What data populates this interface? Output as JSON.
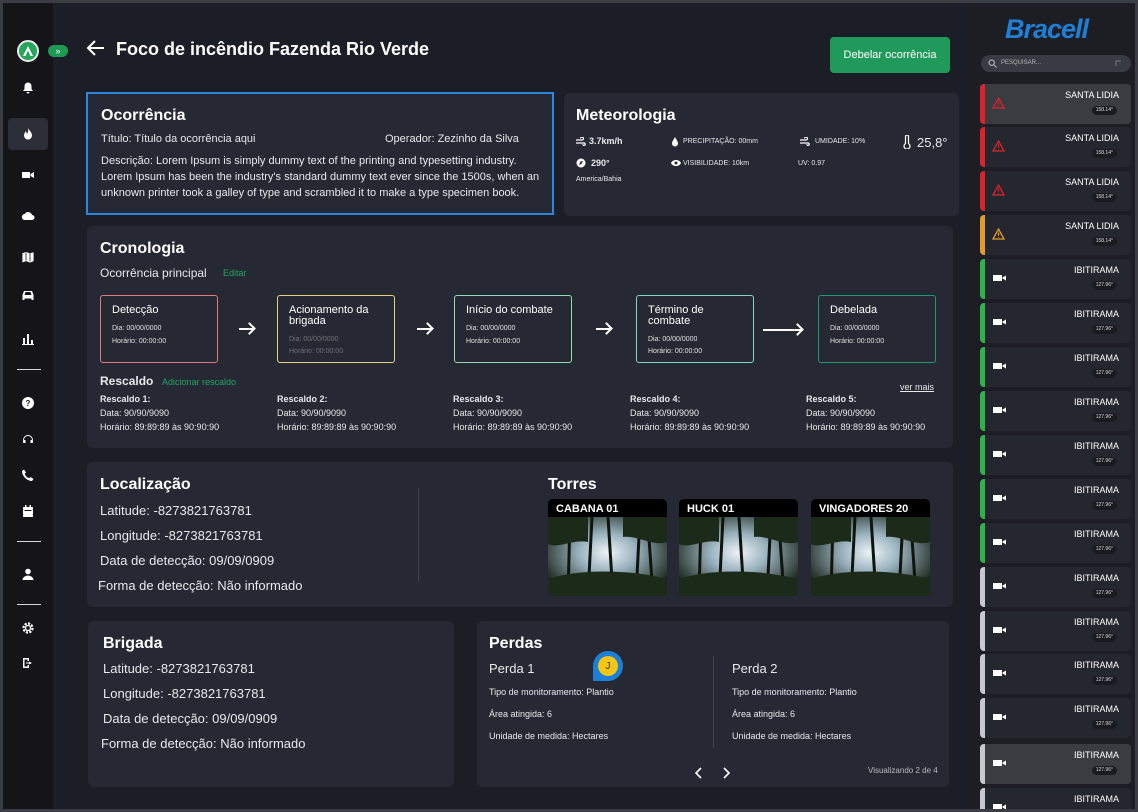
{
  "header": {
    "title": "Foco de incêndio Fazenda Rio Verde",
    "action_button": "Debelar ocorrência"
  },
  "brand": {
    "name": "Bracell"
  },
  "search": {
    "placeholder": "PESQUISAR..."
  },
  "ocorrencia": {
    "title": "Ocorrência",
    "titulo": "Título: Título da ocorrência aqui",
    "operador": "Operador: Zezinho da Silva",
    "descricao_lines": [
      "Descrição: Lorem Ipsum is simply dummy text of the printing and typesetting industry.",
      "Lorem Ipsum has been the industry's standard dummy text ever since the 1500s, when an",
      "unknown printer took a galley of type and scrambled it to make a type specimen book."
    ]
  },
  "meteorologia": {
    "title": "Meteorologia",
    "wind_speed": "3.7km/h",
    "precipitacao": "PRECIPITAÇÃO: 00mm",
    "umidade": "UMIDADE: 10%",
    "temperatura": "25,8°",
    "wind_dir": "290°",
    "visibilidade": "VISIBILIDADE: 10km",
    "uv": "UV: 0.97",
    "timezone": "America/Bahia"
  },
  "cronologia": {
    "title": "Cronologia",
    "subtitle": "Ocorrência principal",
    "edit_link": "Editar",
    "nodes": [
      {
        "title": "Detecção",
        "dia": "Dia: 00/00/0000",
        "hora": "Horário: 00:00:00",
        "color": "#e0787e"
      },
      {
        "title": "Acionamento da brigada",
        "dia": "Dia: 00/00/0000",
        "hora": "Horário: 00:00:00",
        "color": "#e8d07a"
      },
      {
        "title": "Início do combate",
        "dia": "Dia: 00/00/0000",
        "hora": "Horário: 00:00:00",
        "color": "#8fdcbf"
      },
      {
        "title": "Término de combate",
        "dia": "Dia: 00/00/0000",
        "hora": "Horário: 00:00:00",
        "color": "#7fd8c4"
      },
      {
        "title": "Debelada",
        "dia": "Dia: 00/00/0000",
        "hora": "Horário: 00:00:00",
        "color": "#1f9a6a"
      }
    ],
    "rescaldo_title": "Rescaldo",
    "rescaldo_add": "Adicionar rescaldo",
    "ver_mais": "ver mais",
    "rescaldos": [
      {
        "name": "Rescaldo 1:",
        "data": "Data: 90/90/9090",
        "horario": "Horário: 89:89:89 às 90:90:90"
      },
      {
        "name": "Rescaldo 2:",
        "data": "Data: 90/90/9090",
        "horario": "Horário: 89:89:89 às 90:90:90"
      },
      {
        "name": "Rescaldo 3:",
        "data": "Data: 90/90/9090",
        "horario": "Horário: 89:89:89 às 90:90:90"
      },
      {
        "name": "Rescaldo 4:",
        "data": "Data: 90/90/9090",
        "horario": "Horário: 89:89:89 às 90:90:90"
      },
      {
        "name": "Rescaldo 5:",
        "data": "Data: 90/90/9090",
        "horario": "Horário: 89:89:89 às 90:90:90"
      }
    ]
  },
  "localizacao": {
    "title": "Localização",
    "latitude": "Latitude: -8273821763781",
    "longitude": "Longitude: -8273821763781",
    "data": "Data de detecção: 09/09/0909",
    "forma": "Forma de detecção: Não informado"
  },
  "torres": {
    "title": "Torres",
    "items": [
      "CABANA 01",
      "HUCK 01",
      "VINGADORES 20"
    ]
  },
  "brigada": {
    "title": "Brigada",
    "latitude": "Latitude: -8273821763781",
    "longitude": "Longitude: -8273821763781",
    "data": "Data de detecção: 09/09/0909",
    "forma": "Forma de detecção: Não informado"
  },
  "perdas": {
    "title": "Perdas",
    "items": [
      {
        "name": "Perda 1",
        "tipo": "Tipo de monitoramento: Plantio",
        "area": "Área atingida: 6",
        "unidade": "Unidade de medida: Hectares"
      },
      {
        "name": "Perda 2",
        "tipo": "Tipo de monitoramento: Plantio",
        "area": "Área atingida: 6",
        "unidade": "Unidade de medida: Hectares"
      }
    ],
    "pagination": "Visualizando 2 de 4",
    "avatar_letter": "J"
  },
  "alerts": [
    {
      "name": "SANTA LIDIA",
      "badge": "158.14°",
      "type": "warning",
      "color": "#d8242a",
      "selected": true
    },
    {
      "name": "SANTA LIDIA",
      "badge": "158.14°",
      "type": "warning",
      "color": "#d8242a",
      "selected": false
    },
    {
      "name": "SANTA LIDIA",
      "badge": "158.14°",
      "type": "warning",
      "color": "#d8242a",
      "selected": false
    },
    {
      "name": "SANTA LIDIA",
      "badge": "158.14°",
      "type": "warning",
      "color": "#e09b2a",
      "selected": false
    },
    {
      "name": "IBITIRAMA",
      "badge": "127.96°",
      "type": "camera",
      "color": "#2db34a",
      "selected": false
    },
    {
      "name": "IBITIRAMA",
      "badge": "127.96°",
      "type": "camera",
      "color": "#2db34a",
      "selected": false
    },
    {
      "name": "IBITIRAMA",
      "badge": "127.96°",
      "type": "camera",
      "color": "#2db34a",
      "selected": false
    },
    {
      "name": "IBITIRAMA",
      "badge": "127.96°",
      "type": "camera",
      "color": "#2db34a",
      "selected": false
    },
    {
      "name": "IBITIRAMA",
      "badge": "127.96°",
      "type": "camera",
      "color": "#2db34a",
      "selected": false
    },
    {
      "name": "IBITIRAMA",
      "badge": "127.96°",
      "type": "camera",
      "color": "#2db34a",
      "selected": false
    },
    {
      "name": "IBITIRAMA",
      "badge": "127.96°",
      "type": "camera",
      "color": "#2db34a",
      "selected": false
    },
    {
      "name": "IBITIRAMA",
      "badge": "127.96°",
      "type": "camera",
      "color": "#c8c8d0",
      "selected": false
    },
    {
      "name": "IBITIRAMA",
      "badge": "127.96°",
      "type": "camera",
      "color": "#c8c8d0",
      "selected": false
    },
    {
      "name": "IBITIRAMA",
      "badge": "127.96°",
      "type": "camera",
      "color": "#c8c8d0",
      "selected": false
    },
    {
      "name": "IBITIRAMA",
      "badge": "127.96°",
      "type": "camera",
      "color": "#c8c8d0",
      "selected": false
    },
    {
      "name": "IBITIRAMA",
      "badge": "127.96°",
      "type": "camera",
      "color": "#c8c8d0",
      "selected": true
    },
    {
      "name": "IBITIRAMA",
      "badge": "127.96°",
      "type": "camera",
      "color": "#c8c8d0",
      "selected": false
    }
  ]
}
